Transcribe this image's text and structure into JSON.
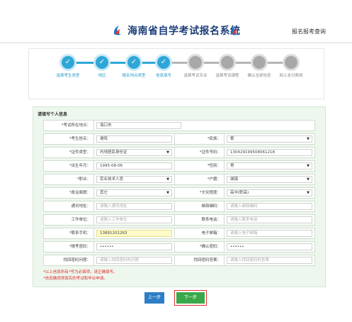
{
  "header": {
    "title": "海南省自学考试报名系统",
    "query_link": "报名报考查询",
    "logo_icon": "hainan-emblem-icon",
    "brand_color": "#1d3e7a"
  },
  "steps": [
    {
      "label": "选择考生类型",
      "status": "done"
    },
    {
      "label": "地区",
      "status": "done"
    },
    {
      "label": "报名地点类型",
      "status": "done"
    },
    {
      "label": "信息填写",
      "status": "done"
    },
    {
      "label": "选择考试专业",
      "status": "todo"
    },
    {
      "label": "选择考试课程",
      "status": "todo"
    },
    {
      "label": "确认全部信息",
      "status": "todo"
    },
    {
      "label": "网上支付费用",
      "status": "todo"
    }
  ],
  "form": {
    "title": "请填写个人信息",
    "location": {
      "label": "*考试所在地点：",
      "value": "海口市"
    },
    "name": {
      "label": "*考生姓名：",
      "value": "谢晖"
    },
    "ethnicity": {
      "label": "*民族：",
      "value": "黎"
    },
    "id_type": {
      "label": "*证件类型：",
      "value": "内地居民身份证"
    },
    "id_number": {
      "label": "*证件号码：",
      "value": "130429199508061218"
    },
    "birth": {
      "label": "*出生年月：",
      "value": "1995-08-06"
    },
    "gender": {
      "label": "*性别：",
      "value": "男"
    },
    "occupation": {
      "label": "*职业：",
      "value": "农业技术人员"
    },
    "hukou": {
      "label": "*户籍：",
      "value": "城镇"
    },
    "political": {
      "label": "*政治面貌：",
      "value": "其它"
    },
    "education": {
      "label": "*文化程度：",
      "value": "高中(职高)"
    },
    "address": {
      "label": "通讯地址：",
      "placeholder": "请输入通讯地址"
    },
    "postcode": {
      "label": "邮政编码：",
      "placeholder": "请输入邮政编码"
    },
    "workplace": {
      "label": "工作单位：",
      "placeholder": "请输入工作单位"
    },
    "phone": {
      "label": "联系电话：",
      "placeholder": "请输入联系电话"
    },
    "mobile": {
      "label": "*联系手机：",
      "value": "13891201263"
    },
    "email": {
      "label": "电子邮箱：",
      "placeholder": "请输入电子邮箱"
    },
    "password": {
      "label": "*报考密码：",
      "value": "••••••"
    },
    "confirm_password": {
      "label": "*确认密码：",
      "value": "••••••"
    },
    "security_question": {
      "label": "找回密码问题：",
      "placeholder": "请输入找回密码的问题"
    },
    "security_answer": {
      "label": "找回密码答案：",
      "placeholder": "请输入找回密码的答案"
    },
    "notice_1": "*以上信息所有*号为必填项，请正确填写。",
    "notice_2": "*信息确须得真实的考试和毕业申请。"
  },
  "buttons": {
    "prev": "上一步",
    "next": "下一步"
  },
  "colors": {
    "step_done": "#2ea7d8",
    "step_todo": "#a8a8a8",
    "panel_bg": "#eef7ee",
    "next_button": "#3aa84a",
    "prev_button": "#2e7ec5",
    "required": "#e03030"
  }
}
